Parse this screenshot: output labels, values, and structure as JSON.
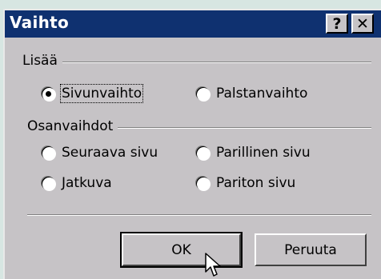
{
  "window": {
    "title": "Vaihto",
    "help_label": "?",
    "close_label": "✕"
  },
  "insert_group": {
    "label": "Lisää",
    "options": [
      {
        "label": "Sivunvaihto",
        "checked": true
      },
      {
        "label": "Palstanvaihto",
        "checked": false
      }
    ]
  },
  "section_group": {
    "label": "Osanvaihdot",
    "options": [
      {
        "label": "Seuraava sivu",
        "checked": false
      },
      {
        "label": "Parillinen sivu",
        "checked": false
      },
      {
        "label": "Jatkuva",
        "checked": false
      },
      {
        "label": "Pariton sivu",
        "checked": false
      }
    ]
  },
  "buttons": {
    "ok_label": "OK",
    "cancel_label": "Peruuta"
  },
  "icons": {
    "help": "help-icon",
    "close": "close-icon",
    "cursor": "mouse-pointer-icon"
  },
  "colors": {
    "titlebar": "#0f3170",
    "dialog_face": "#c6c3c6",
    "backdrop": "#d7e6e2"
  }
}
